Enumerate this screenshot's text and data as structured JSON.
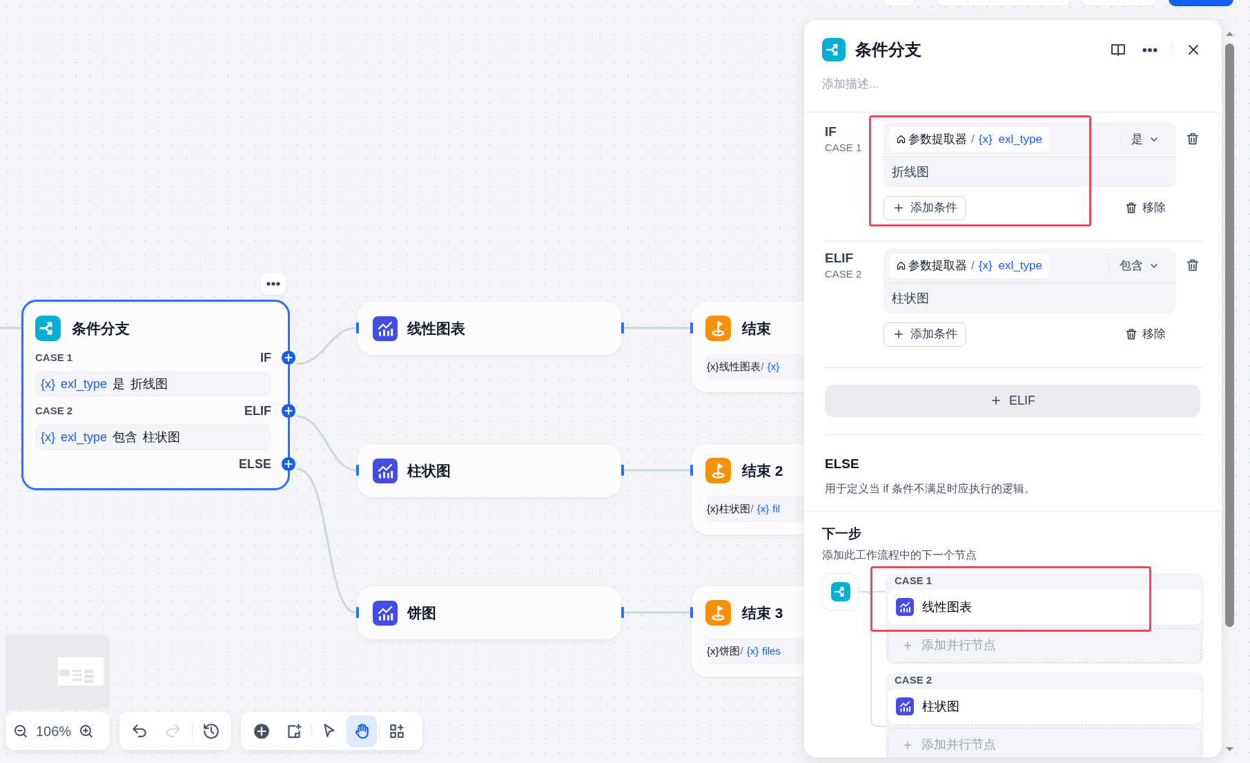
{
  "top_buttons": [
    {
      "kind": "plain"
    },
    {
      "kind": "plain"
    },
    {
      "kind": "plain"
    },
    {
      "kind": "primary"
    }
  ],
  "canvas": {
    "condition_node": {
      "title": "条件分支",
      "selected": true,
      "cases": [
        {
          "case_label": "CASE 1",
          "branch": "IF",
          "var_mark": "{x}",
          "variable": "exl_type",
          "operator": "是",
          "value": "折线图"
        },
        {
          "case_label": "CASE 2",
          "branch": "ELIF",
          "var_mark": "{x}",
          "variable": "exl_type",
          "operator": "包含",
          "value": "柱状图"
        }
      ],
      "else_label": "ELSE"
    },
    "chart_nodes": [
      {
        "title": "线性图表",
        "selected": false
      },
      {
        "title": "柱状图",
        "selected": false
      },
      {
        "title": "饼图",
        "selected": false
      }
    ],
    "end_nodes": [
      {
        "title": "结束",
        "var_mark": "{x}",
        "source": "线性图表",
        "separator": "/",
        "var_mark_2": "{x}"
      },
      {
        "title": "结束 2",
        "var_mark": "{x}",
        "source": "柱状图",
        "separator": "/",
        "var_mark_2": "{x}",
        "variable": "fil"
      },
      {
        "title": "结束 3",
        "var_mark": "{x}",
        "source": "饼图",
        "separator": "/",
        "var_mark_2": "{x}",
        "variable": "files"
      }
    ]
  },
  "toolbar": {
    "zoom": "106%",
    "history_tools": [
      {
        "kind": "undo",
        "disabled": false
      },
      {
        "kind": "redo",
        "disabled": true
      },
      {
        "kind": "history",
        "disabled": false
      }
    ],
    "tools": [
      {
        "kind": "add-node",
        "selected": false
      },
      {
        "kind": "add-note",
        "selected": false
      },
      {
        "kind": "pointer",
        "selected": false
      },
      {
        "kind": "hand",
        "selected": true
      },
      {
        "kind": "organize",
        "selected": false
      }
    ]
  },
  "panel": {
    "title": "条件分支",
    "description": {
      "placeholder": "添加描述..."
    },
    "cases": [
      {
        "branch": "IF",
        "case_label": "CASE 1",
        "source_node": "参数提取器",
        "separator": "/",
        "var_mark": "{x}",
        "variable": "exl_type",
        "operator": "是",
        "value": "折线图",
        "add_button": "添加条件",
        "remove_button": "移除"
      },
      {
        "branch": "ELIF",
        "case_label": "CASE 2",
        "source_node": "参数提取器",
        "separator": "/",
        "var_mark": "{x}",
        "variable": "exl_type",
        "operator": "包含",
        "value": "柱状图",
        "add_button": "添加条件",
        "remove_button": "移除"
      }
    ],
    "add_elif_button": "ELIF",
    "else": {
      "title": "ELSE",
      "description": "用于定义当 if 条件不满足时应执行的逻辑。"
    },
    "next_step": {
      "title": "下一步",
      "description": "添加此工作流程中的下一个节点",
      "branches": [
        {
          "case_label": "CASE 1",
          "node": "线性图表",
          "add_parallel": "添加并行节点"
        },
        {
          "case_label": "CASE 2",
          "node": "柱状图",
          "add_parallel": "添加并行节点"
        }
      ]
    }
  }
}
